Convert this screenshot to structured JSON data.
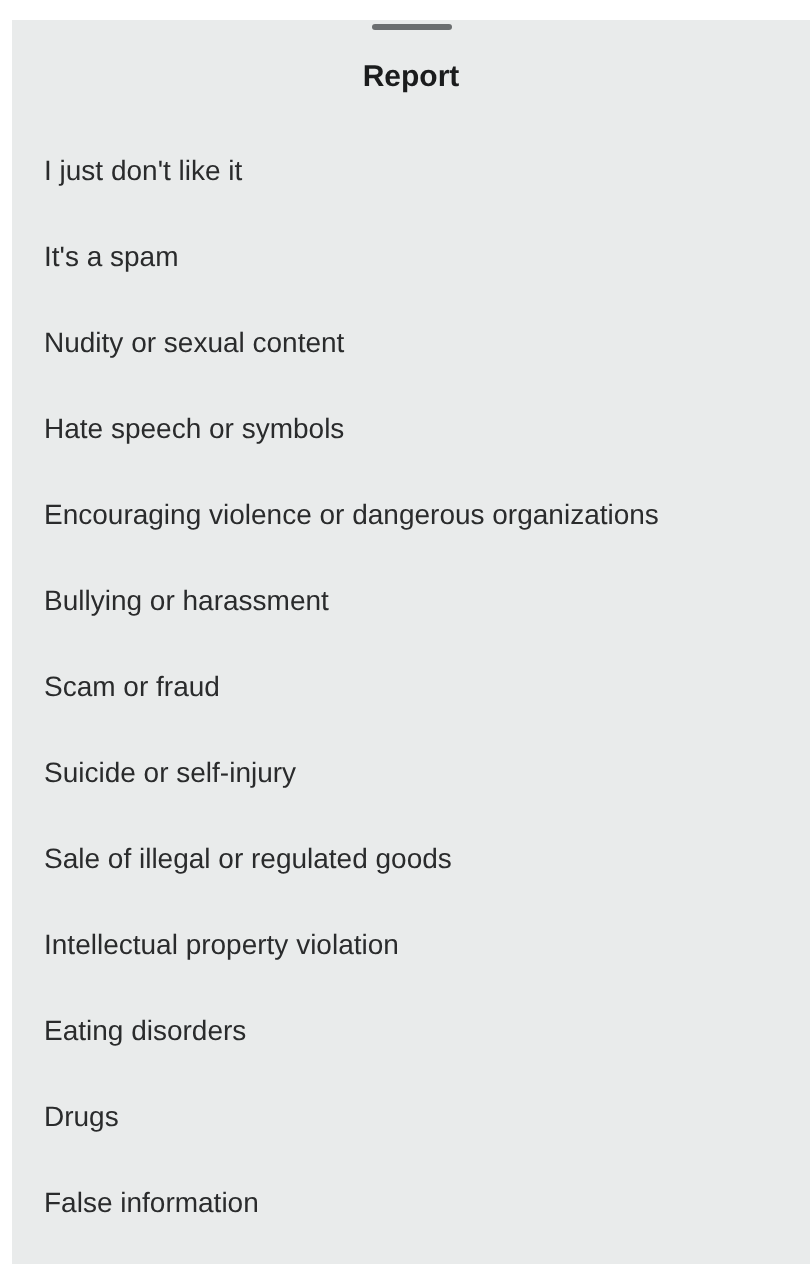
{
  "title": "Report",
  "options": [
    "I just don't like it",
    "It's a spam",
    "Nudity or sexual content",
    "Hate speech or symbols",
    "Encouraging violence or dangerous organizations",
    "Bullying or harassment",
    "Scam or fraud",
    "Suicide or self-injury",
    "Sale of illegal or regulated goods",
    "Intellectual property violation",
    "Eating disorders",
    "Drugs",
    "False information"
  ]
}
